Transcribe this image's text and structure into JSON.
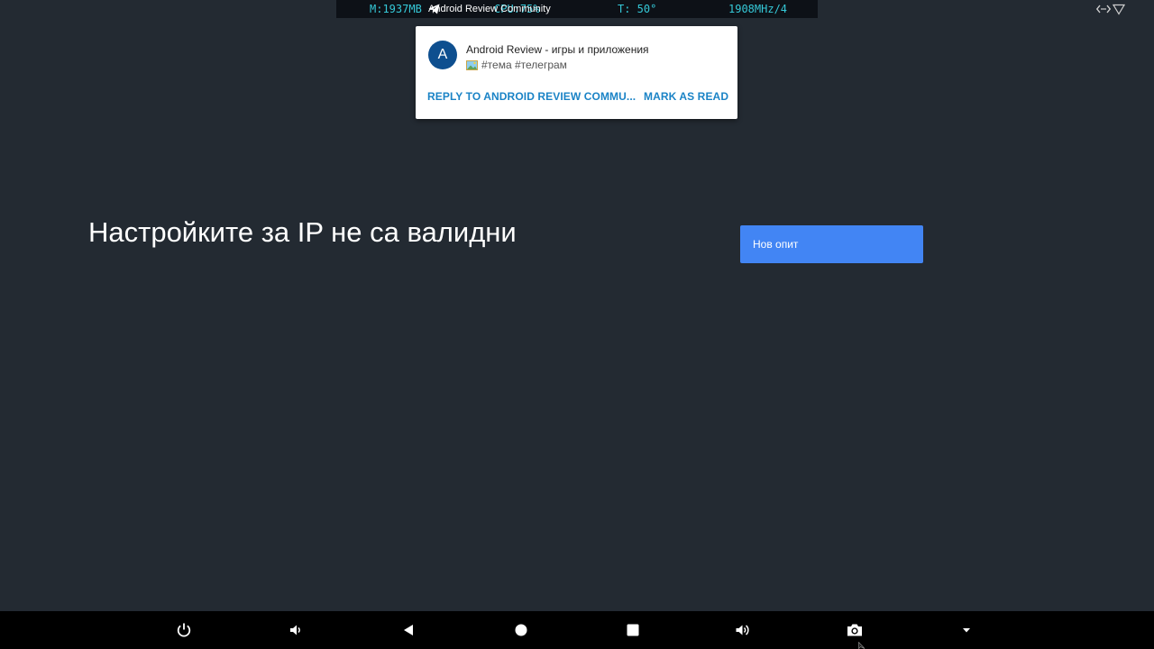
{
  "status_overlay": {
    "memory": "M:1937MB",
    "cpu": "CPU:75%",
    "temperature": "T: 50°",
    "frequency": "1908MHz/4",
    "ticker_text": "Android Review Community",
    "text_color": "#35c9d8"
  },
  "notification": {
    "avatar_letter": "A",
    "avatar_color": "#0e4f8f",
    "title": "Android Review - игры и приложения",
    "body": "#тема #телеграм",
    "actions": {
      "reply": "REPLY TO ANDROID REVIEW COMMU...",
      "mark_read": "MARK AS READ"
    },
    "action_color": "#1a83c6"
  },
  "main": {
    "error_title": "Настройките за IP не са валидни",
    "retry_button_label": "Нов опит",
    "button_color": "#4285f4",
    "background_color": "#232a32"
  },
  "nav_bar": {
    "icons": [
      "power-icon",
      "volume-down-icon",
      "back-icon",
      "home-icon",
      "recents-icon",
      "volume-up-icon",
      "camera-icon",
      "dropdown-icon"
    ]
  }
}
